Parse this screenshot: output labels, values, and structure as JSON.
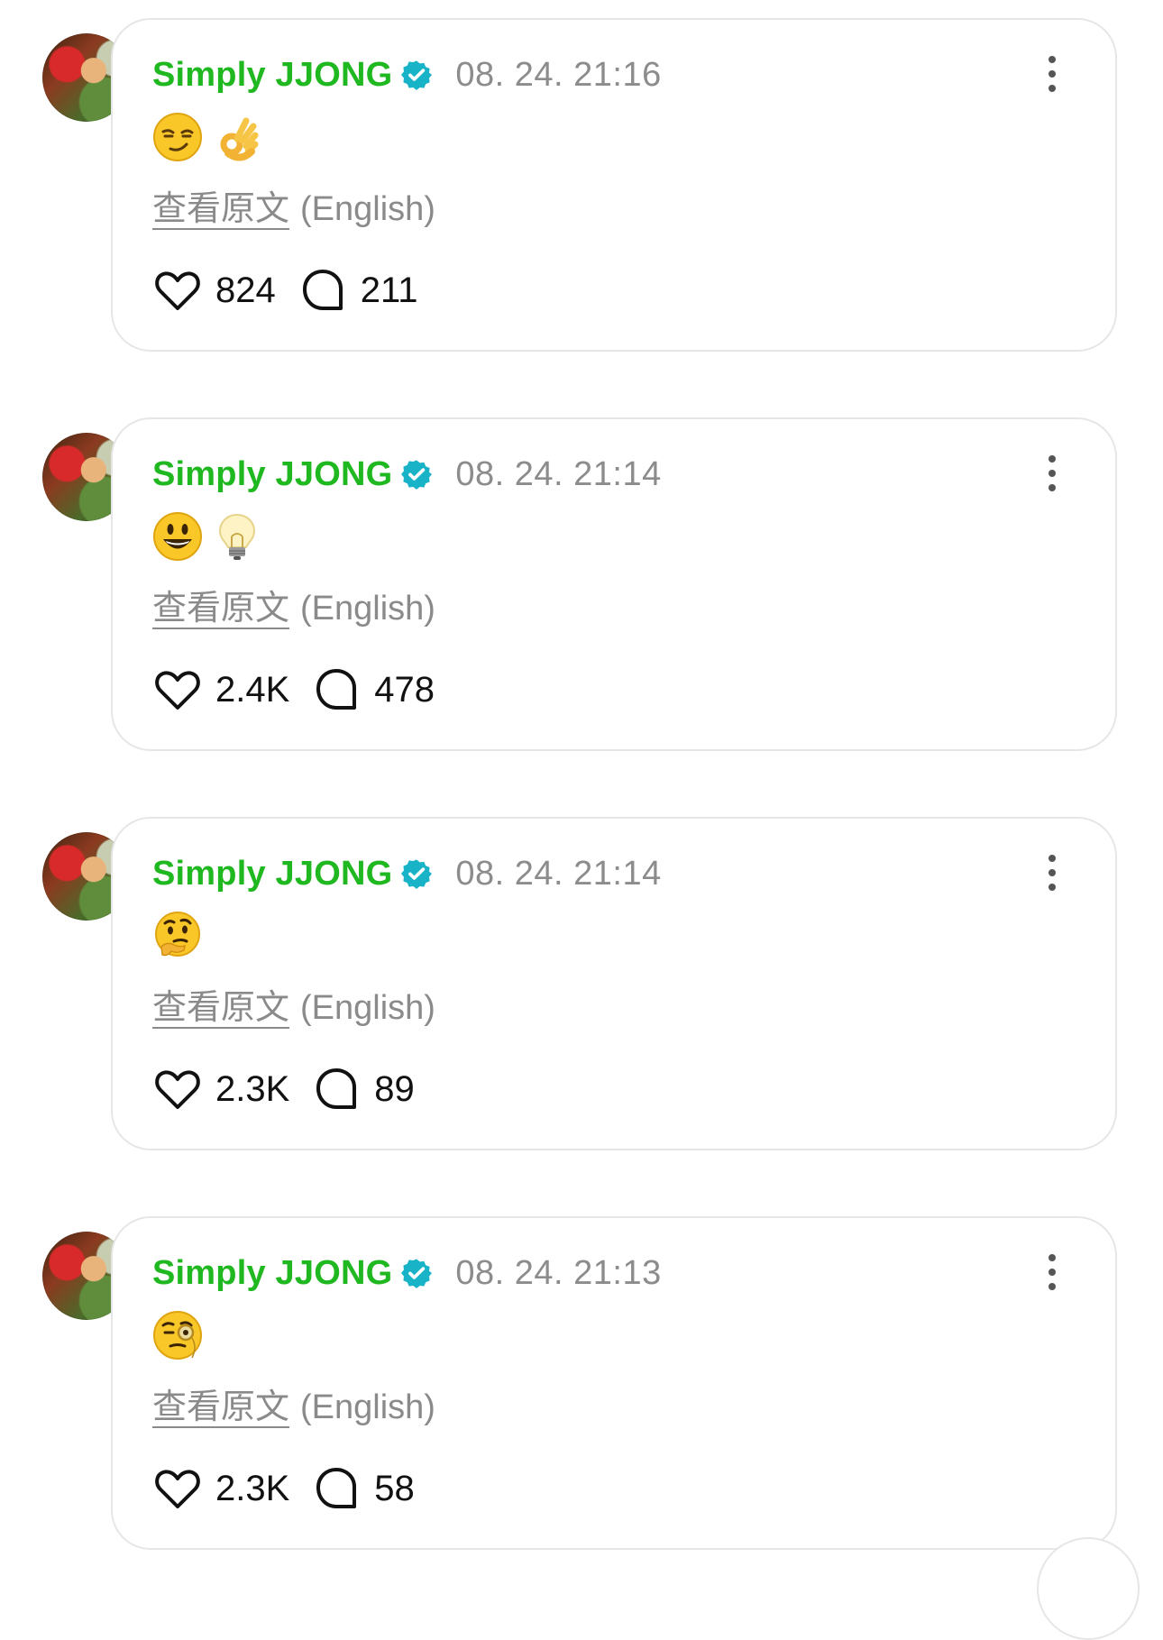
{
  "posts": [
    {
      "author": "Simply JJONG",
      "time": "08. 24. 21:16",
      "emojis": [
        "smirk",
        "ok-hand"
      ],
      "translate_link": "查看原文",
      "translate_lang": "(English)",
      "likes": "824",
      "comments": "211"
    },
    {
      "author": "Simply JJONG",
      "time": "08. 24. 21:14",
      "emojis": [
        "grin",
        "light-bulb"
      ],
      "translate_link": "查看原文",
      "translate_lang": "(English)",
      "likes": "2.4K",
      "comments": "478"
    },
    {
      "author": "Simply JJONG",
      "time": "08. 24. 21:14",
      "emojis": [
        "thinking"
      ],
      "translate_link": "查看原文",
      "translate_lang": "(English)",
      "likes": "2.3K",
      "comments": "89"
    },
    {
      "author": "Simply JJONG",
      "time": "08. 24. 21:13",
      "emojis": [
        "monocle"
      ],
      "translate_link": "查看原文",
      "translate_lang": "(English)",
      "likes": "2.3K",
      "comments": "58"
    }
  ],
  "colors": {
    "author": "#20b820",
    "verified": "#19b3c8",
    "muted": "#8c8c8c",
    "border": "#e6e6e6"
  }
}
